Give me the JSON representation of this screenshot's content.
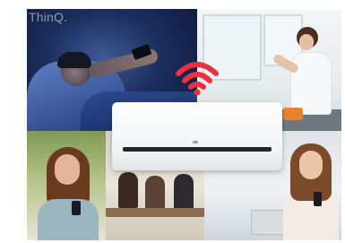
{
  "brand": {
    "text": "ThinQ."
  },
  "colors": {
    "wifi": "#e8333f",
    "ac_body": "#f4f5f6"
  },
  "icons": {
    "wifi": "wifi-icon"
  }
}
